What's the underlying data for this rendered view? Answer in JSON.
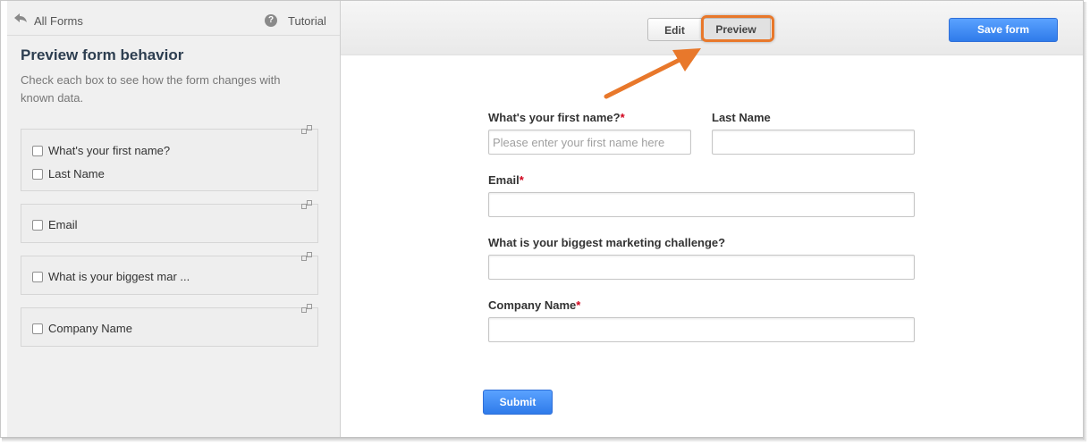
{
  "sidebar": {
    "back_label": "All Forms",
    "tutorial_label": "Tutorial",
    "help_glyph": "?",
    "title": "Preview form behavior",
    "description": "Check each box to see how the form changes with known data.",
    "groups": [
      {
        "items": [
          "What's your first name?",
          "Last Name"
        ]
      },
      {
        "items": [
          "Email"
        ]
      },
      {
        "items": [
          "What is your biggest mar ..."
        ]
      },
      {
        "items": [
          "Company Name"
        ]
      }
    ]
  },
  "toolbar": {
    "edit_label": "Edit",
    "preview_label": "Preview",
    "save_label": "Save form",
    "active_tab": "Preview",
    "highlight_color": "#e8782b"
  },
  "form": {
    "first_name": {
      "label": "What's your first name?",
      "required": "*",
      "placeholder": "Please enter your first name here"
    },
    "last_name": {
      "label": "Last Name"
    },
    "email": {
      "label": "Email",
      "required": "*"
    },
    "challenge": {
      "label": "What is your biggest marketing challenge?"
    },
    "company": {
      "label": "Company Name",
      "required": "*"
    },
    "submit_label": "Submit"
  },
  "colors": {
    "primary_button": "#2f7bea",
    "required": "#d0021b",
    "annotation": "#e8782b"
  }
}
